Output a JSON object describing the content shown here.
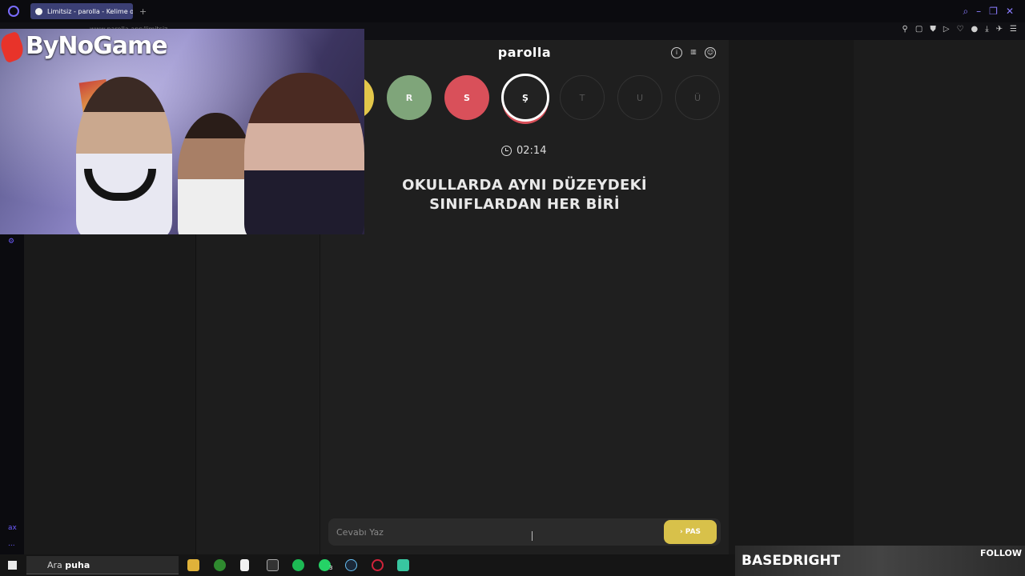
{
  "browser": {
    "tab_title": "Limitsiz - parolla - Kelime o",
    "new_tab_symbol": "+",
    "address": "www.parolla.app/limitsiz"
  },
  "game": {
    "title": "parolla",
    "letters": [
      {
        "letter": "",
        "state": "correct-yellow"
      },
      {
        "letter": "R",
        "state": "correct"
      },
      {
        "letter": "S",
        "state": "wrong"
      },
      {
        "letter": "Ş",
        "state": "active"
      },
      {
        "letter": "T",
        "state": "pending"
      },
      {
        "letter": "U",
        "state": "pending"
      },
      {
        "letter": "Ü",
        "state": "pending"
      }
    ],
    "timer": "02:14",
    "question_line1": "OKULLARDA AYNI DÜZEYDEKİ",
    "question_line2": "SINIFLARDAN HER BİRİ",
    "answer_placeholder": "Cevabı Yaz",
    "pass_label": "› PAS"
  },
  "overlay": {
    "brand": "ByNoGame"
  },
  "taskbar": {
    "search_prefix": "Ara",
    "search_value": "puha",
    "badge_count": "3"
  },
  "stream": {
    "channel": "BASEDRIGHT",
    "follow_label": "FOLLOW"
  },
  "sidebar": {
    "ai_label": "ax",
    "more_label": "..."
  },
  "colors": {
    "yellow": "#e3c74a",
    "green": "#7fa57a",
    "red": "#d9505a",
    "pas_button": "#d8c14a"
  }
}
